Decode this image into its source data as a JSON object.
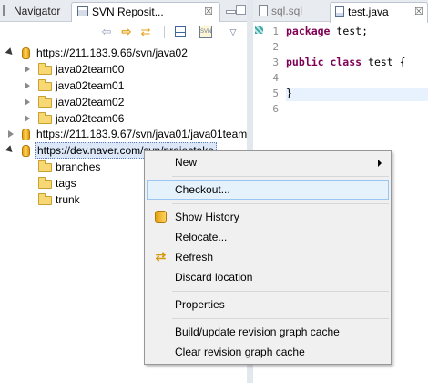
{
  "left_view": {
    "tabs": [
      {
        "label": "Navigator"
      },
      {
        "label": "SVN Reposit...",
        "close": "☒"
      }
    ],
    "toolbar": {
      "back_icon": "back-arrow-icon",
      "forward_icon": "forward-arrow-icon",
      "sync_icon": "sync-icon",
      "collapse_icon": "collapse-all-icon",
      "new_repo_icon": "new-repository-location-icon",
      "view_menu_icon": "view-menu-chevron-icon"
    },
    "tree": [
      {
        "label": "https://211.183.9.66/svn/java02",
        "kind": "repo",
        "expanded": true
      },
      {
        "label": "java02team00",
        "kind": "folder",
        "expanded": false
      },
      {
        "label": "java02team01",
        "kind": "folder",
        "expanded": false
      },
      {
        "label": "java02team02",
        "kind": "folder",
        "expanded": false
      },
      {
        "label": "java02team06",
        "kind": "folder",
        "expanded": false
      },
      {
        "label": "https://211.183.9.67/svn/java01/java01team",
        "kind": "repo",
        "expanded": false
      },
      {
        "label": "https://dev.naver.com/svn/projectako",
        "kind": "repo",
        "expanded": true,
        "selected": true
      },
      {
        "label": "branches",
        "kind": "folder"
      },
      {
        "label": "tags",
        "kind": "folder"
      },
      {
        "label": "trunk",
        "kind": "folder"
      }
    ]
  },
  "editor": {
    "tabs": [
      {
        "label": "sql.sql",
        "active": false
      },
      {
        "label": "test.java",
        "active": true,
        "close": "☒"
      }
    ],
    "line_numbers": [
      "1",
      "2",
      "3",
      "4",
      "5",
      "6"
    ],
    "code": [
      {
        "kw": "package",
        "rest": " test;"
      },
      {
        "kw": "",
        "rest": ""
      },
      {
        "kw": "public class",
        "rest": " test {"
      },
      {
        "kw": "",
        "rest": ""
      },
      {
        "kw": "",
        "rest": "}"
      },
      {
        "kw": "",
        "rest": ""
      }
    ]
  },
  "context_menu": {
    "items": [
      {
        "label": "New",
        "submenu": true
      },
      {
        "label": "Checkout...",
        "hover": true
      },
      {
        "label": "Show History",
        "icon": "show-history-icon"
      },
      {
        "label": "Relocate..."
      },
      {
        "label": "Refresh",
        "icon": "refresh-icon"
      },
      {
        "label": "Discard location"
      },
      {
        "label": "Properties"
      },
      {
        "label": "Build/update revision graph cache"
      },
      {
        "label": "Clear revision graph cache"
      }
    ]
  }
}
